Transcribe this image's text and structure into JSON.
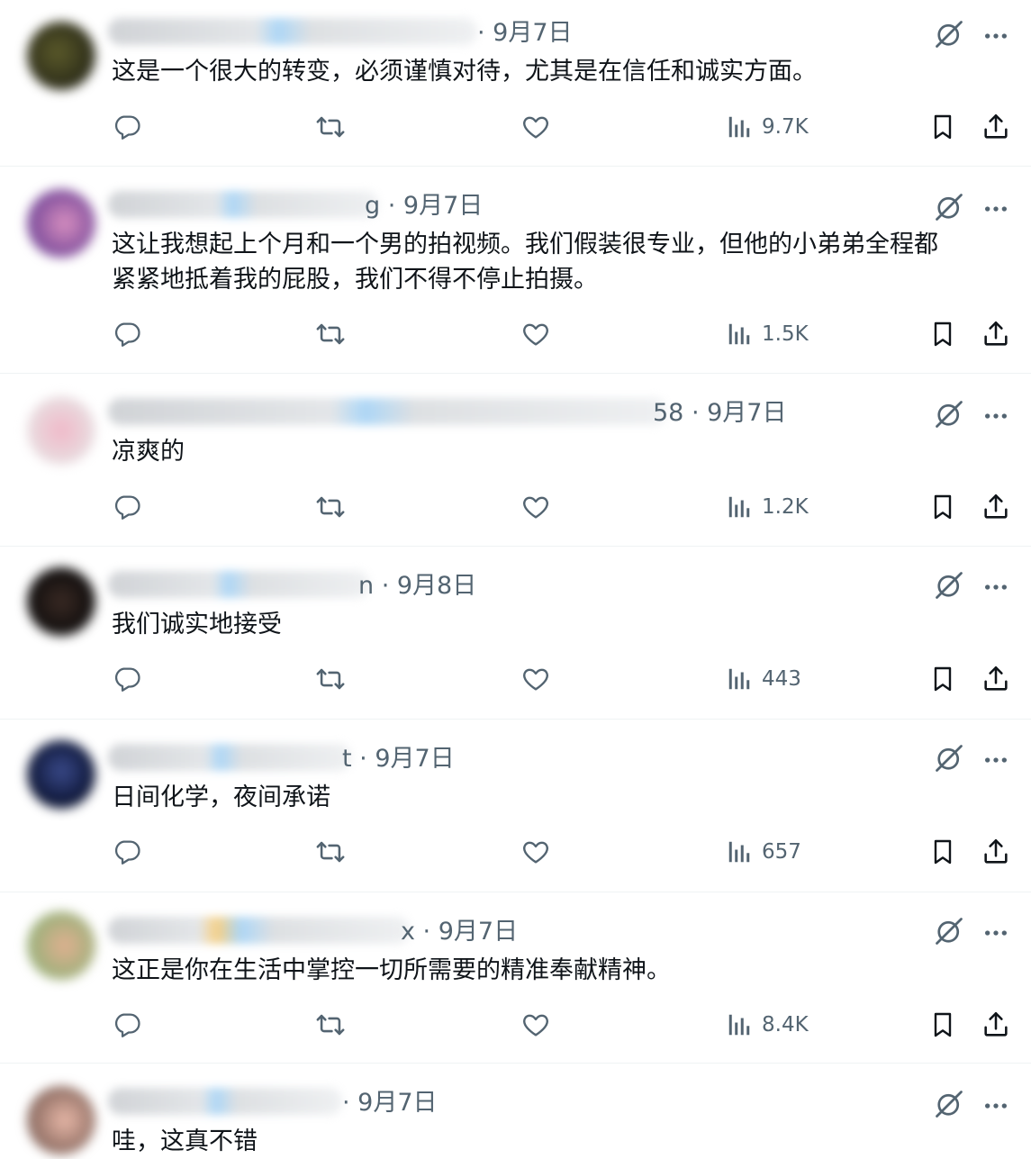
{
  "colors": {
    "text": "#0f1419",
    "muted": "#536471",
    "divider": "#eff3f4",
    "verified": "#1d9bf0"
  },
  "icons": {
    "reply": "speech-bubble-icon",
    "repost": "repost-arrows-icon",
    "like": "heart-icon",
    "views": "bar-chart-icon",
    "bookmark": "bookmark-icon",
    "share": "share-upload-icon",
    "grok": "grok-slash-icon",
    "more": "ellipsis-icon"
  },
  "replies": [
    {
      "date": "· 9月7日",
      "text": "这是一个很大的转变，必须谨慎对待，尤其是在信任和诚实方面。",
      "views": "9.7K"
    },
    {
      "date": "g · 9月7日",
      "text": "这让我想起上个月和一个男的拍视频。我们假装很专业，但他的小弟弟全程都\n紧紧地抵着我的屁股，我们不得不停止拍摄。",
      "views": "1.5K"
    },
    {
      "date": "58 · 9月7日",
      "text": "凉爽的",
      "views": "1.2K"
    },
    {
      "date": "n · 9月8日",
      "text": "我们诚实地接受",
      "views": "443"
    },
    {
      "date": "t · 9月7日",
      "text": "日间化学，夜间承诺",
      "views": "657"
    },
    {
      "date": "x · 9月7日",
      "text": "这正是你在生活中掌控一切所需要的精准奉献精神。",
      "views": "8.4K"
    },
    {
      "date": "· 9月7日",
      "text": "哇，这真不错",
      "views": ""
    }
  ]
}
